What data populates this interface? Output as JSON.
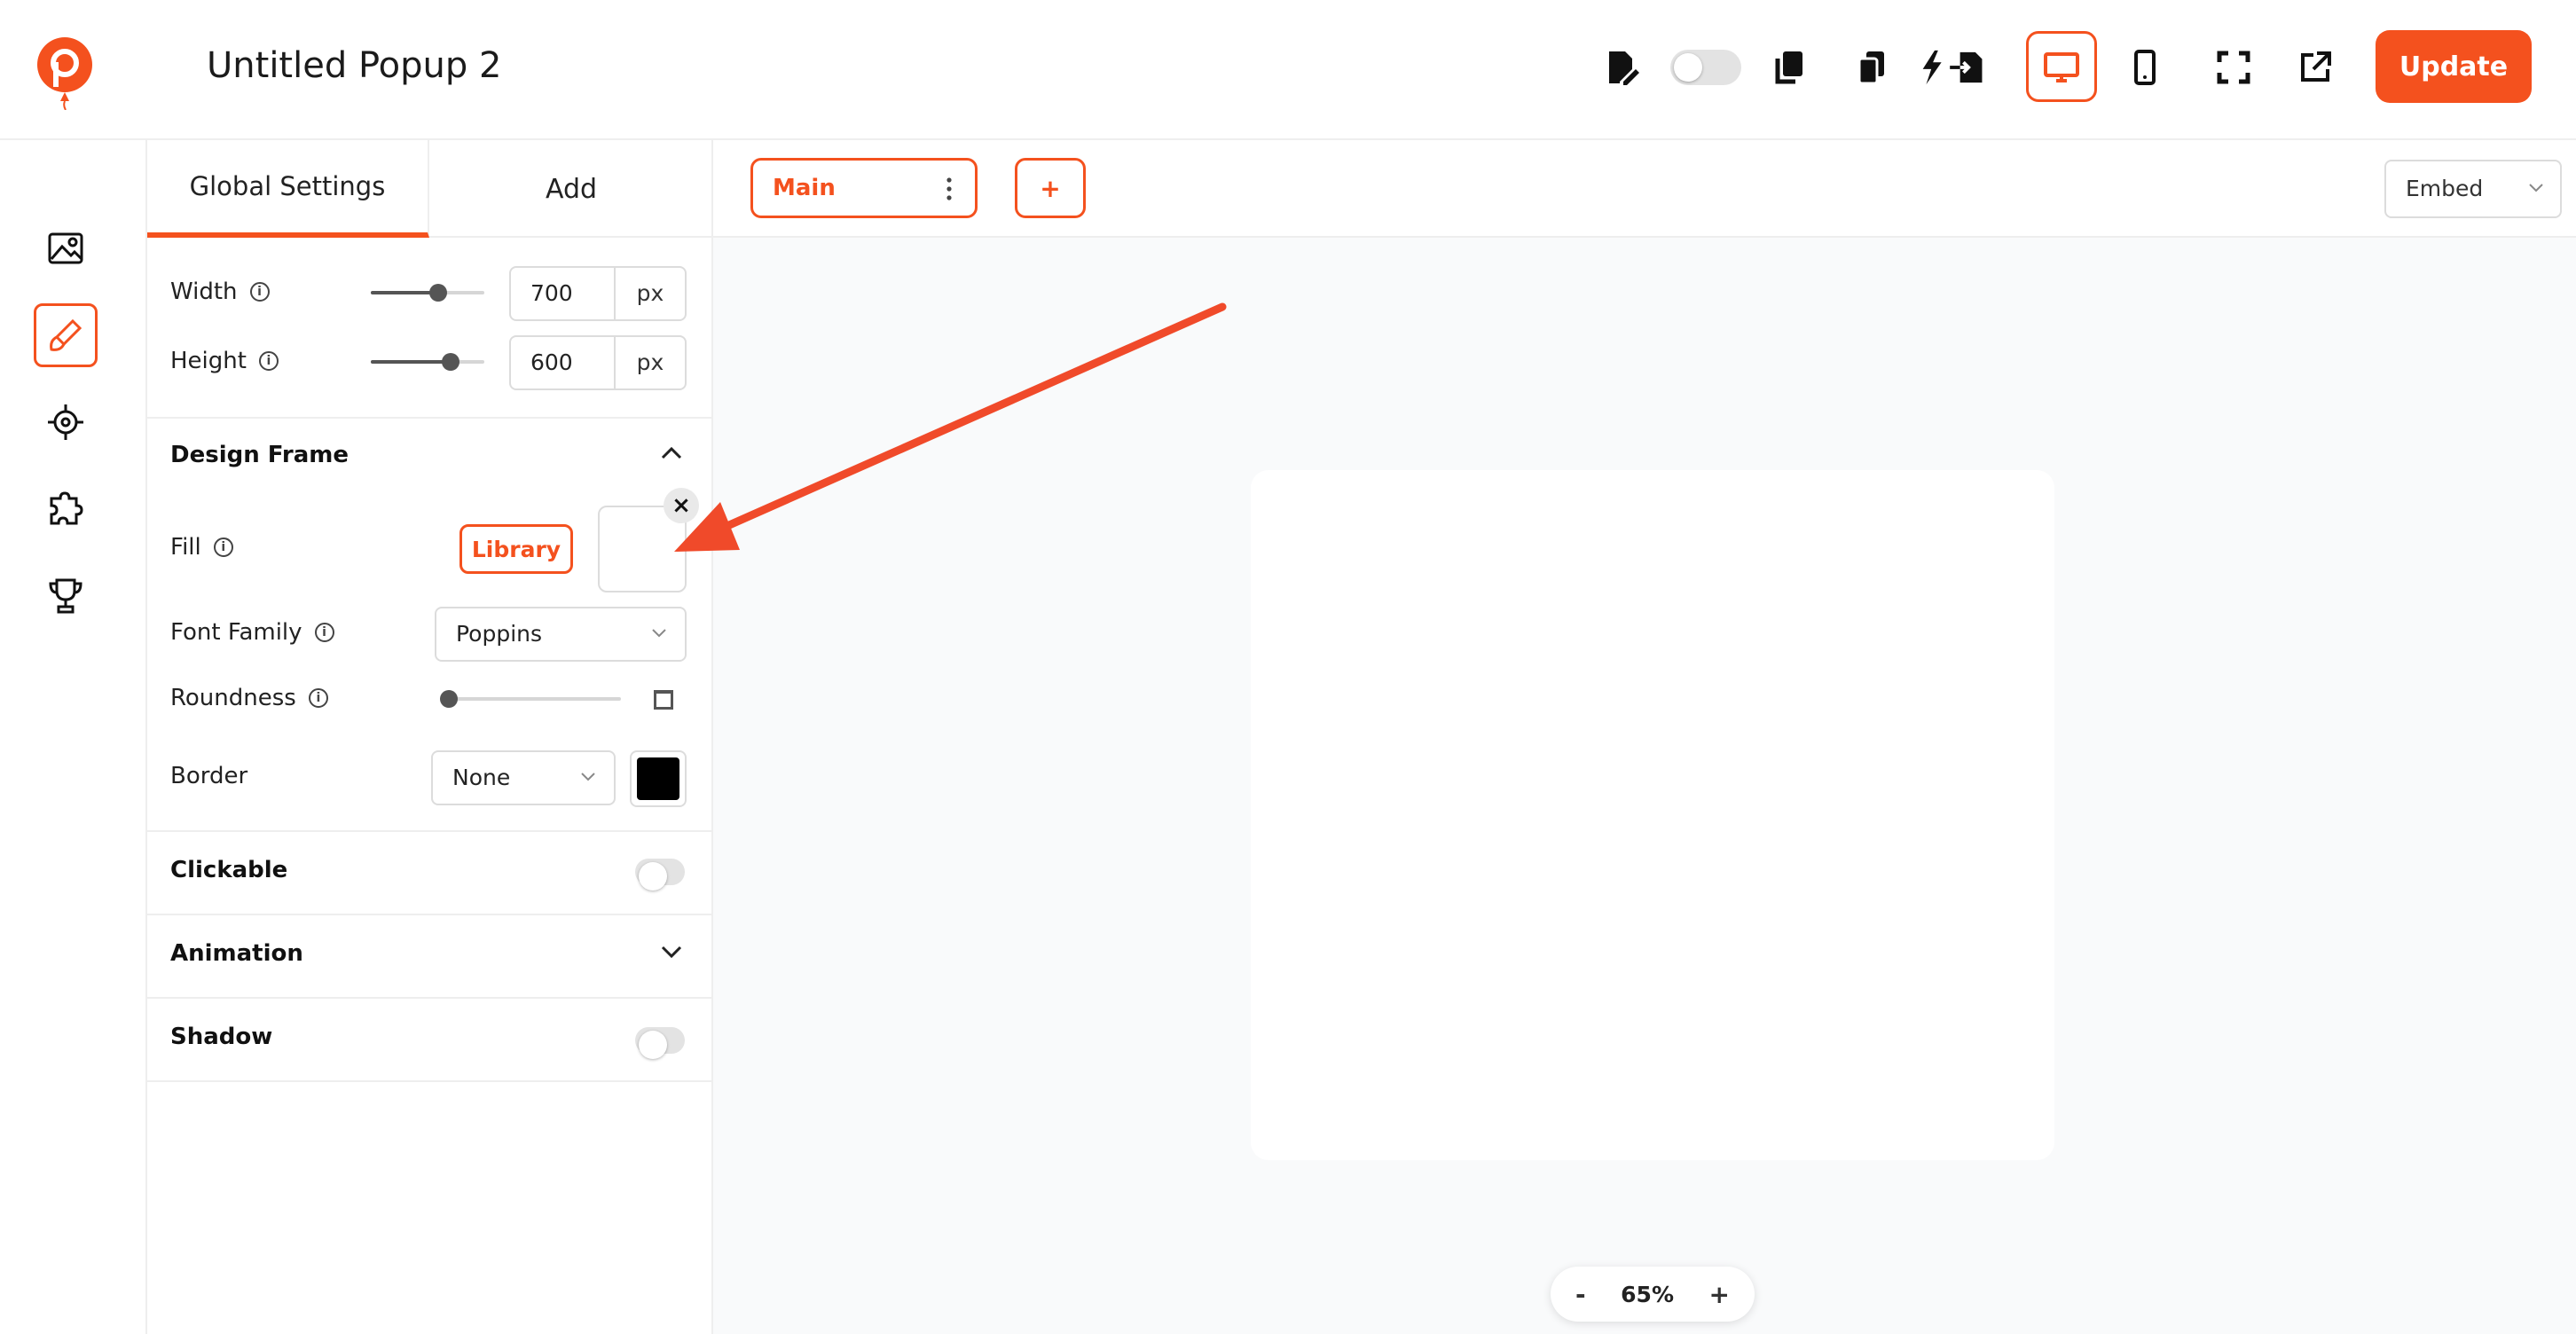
{
  "header": {
    "title": "Untitled Popup 2",
    "update_label": "Update"
  },
  "icons": {
    "logo": "balloon-p-logo",
    "toolbar": [
      "edit-document-icon",
      "toggle",
      "copy-icon",
      "duplicate-icon",
      "flash-export-icon",
      "desktop-icon",
      "mobile-icon",
      "fullscreen-icon",
      "external-link-icon"
    ],
    "rail": [
      "image-icon",
      "brush-icon",
      "target-icon",
      "puzzle-icon",
      "trophy-icon"
    ]
  },
  "panel": {
    "tabs": {
      "global": "Global Settings",
      "add": "Add"
    },
    "width": {
      "label": "Width",
      "value": "700",
      "unit": "px"
    },
    "height": {
      "label": "Height",
      "value": "600",
      "unit": "px"
    },
    "design_frame": {
      "title": "Design Frame",
      "fill_label": "Fill",
      "library_label": "Library",
      "font_family_label": "Font Family",
      "font_family_value": "Poppins",
      "roundness_label": "Roundness",
      "border_label": "Border",
      "border_value": "None",
      "border_color": "#000000"
    },
    "clickable": "Clickable",
    "animation": "Animation",
    "shadow": "Shadow"
  },
  "canvas": {
    "page_tab": "Main",
    "add_page": "+",
    "embed": "Embed",
    "zoom": {
      "minus": "-",
      "value": "65%",
      "plus": "+"
    }
  },
  "colors": {
    "accent": "#f4511e",
    "annotation_arrow": "#f04a2a"
  }
}
